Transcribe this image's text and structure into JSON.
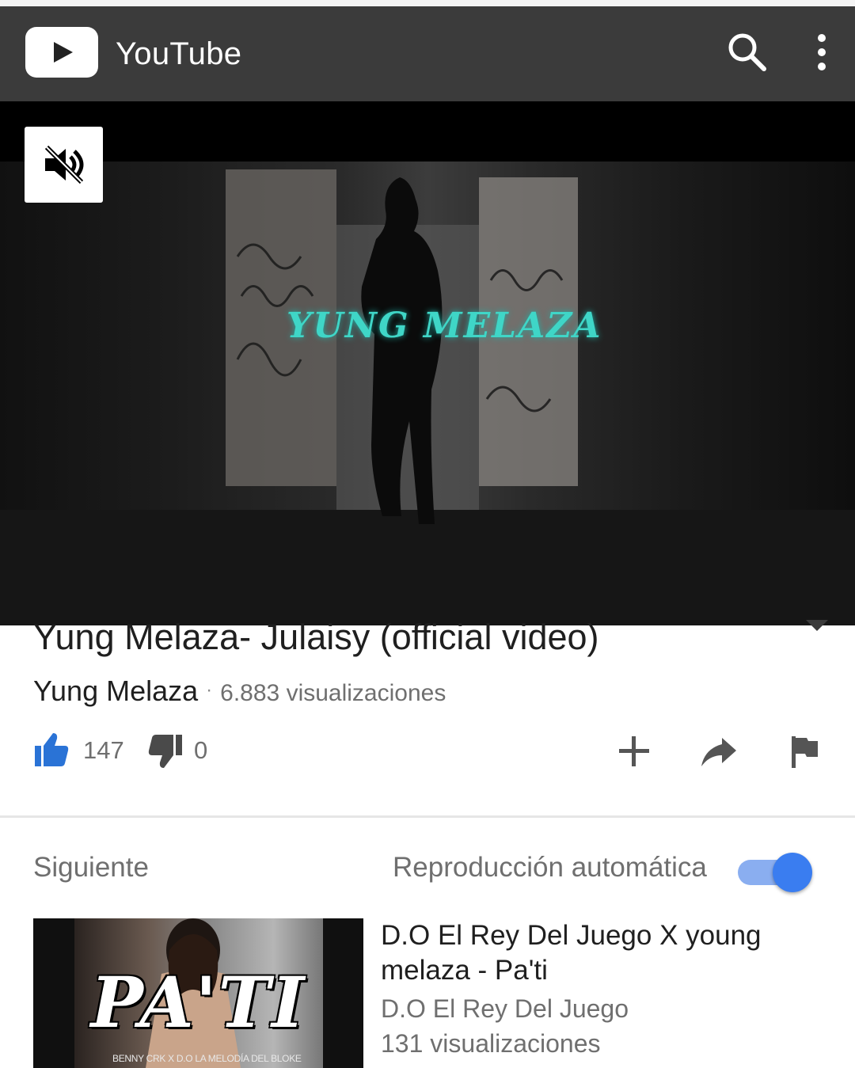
{
  "app": {
    "title": "YouTube",
    "logo_icon": "youtube-play-icon",
    "search_icon": "search-icon",
    "more_icon": "more-vertical-icon"
  },
  "player": {
    "mute_icon": "volume-off-icon",
    "overlay_text": "YUNG MELAZA"
  },
  "video": {
    "title": "Yung Melaza- Julaisy (official video)",
    "channel": "Yung Melaza",
    "views": "6.883 visualizaciones",
    "likes": "147",
    "dislikes": "0",
    "expand_icon": "caret-down-icon"
  },
  "actions": [
    "add-to-playlist-icon",
    "share-icon",
    "flag-icon"
  ],
  "up_next": {
    "label": "Siguiente",
    "autoplay_label": "Reproducción automática",
    "autoplay_on": true,
    "item": {
      "title": "D.O El Rey Del Juego X young melaza - Pa'ti",
      "channel": "D.O El Rey Del Juego",
      "views": "131 visualizaciones",
      "thumb_title": "PA'TI",
      "thumb_credits": "BENNY CRK X D.O LA MELODÍA DEL BLOKE"
    }
  },
  "colors": {
    "appbar": "#3b3b3b",
    "like_active": "#2a73d6",
    "toggle_knob": "#3a7df0",
    "toggle_track": "#8aaef0",
    "overlay_text": "#3fd6c7"
  }
}
